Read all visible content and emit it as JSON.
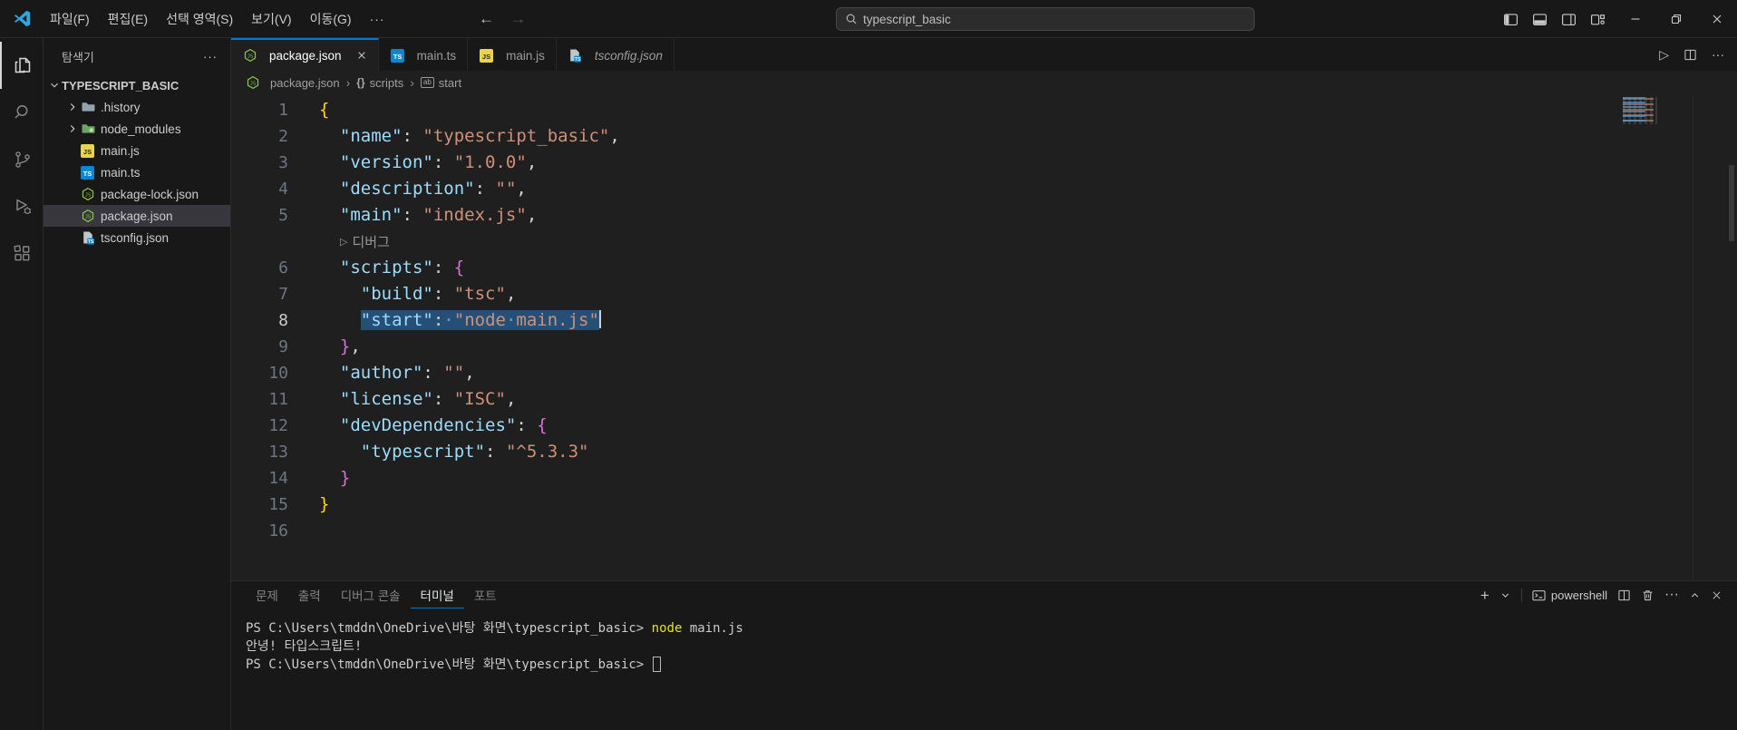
{
  "colors": {
    "accent": "#0078d4",
    "selection": "#264f78",
    "terminal_command_color": "#e5e510",
    "syntax": {
      "k": "#9cdcfe",
      "s": "#ce9178",
      "p": "#d4d4d4",
      "b1": "#ffd700",
      "b2": "#da70d6",
      "w": "#7e97ad"
    }
  },
  "titlebar": {
    "menus": [
      "파일(F)",
      "편집(E)",
      "선택 영역(S)",
      "보기(V)",
      "이동(G)"
    ],
    "menus_overflow": "···",
    "search_text": "typescript_basic"
  },
  "activity_bar": {
    "items": [
      {
        "name": "explorer",
        "active": true
      },
      {
        "name": "search",
        "active": false
      },
      {
        "name": "source-control",
        "active": false
      },
      {
        "name": "run-debug",
        "active": false
      },
      {
        "name": "extensions",
        "active": false
      }
    ]
  },
  "sidebar": {
    "title": "탐색기",
    "title_actions": "···",
    "root_label": "TYPESCRIPT_BASIC",
    "items": [
      {
        "label": ".history",
        "icon": "folder-gray",
        "expandable": true,
        "selected": false
      },
      {
        "label": "node_modules",
        "icon": "folder-green",
        "expandable": true,
        "selected": false
      },
      {
        "label": "main.js",
        "icon": "js",
        "expandable": false,
        "selected": false
      },
      {
        "label": "main.ts",
        "icon": "ts",
        "expandable": false,
        "selected": false
      },
      {
        "label": "package-lock.json",
        "icon": "npm",
        "expandable": false,
        "selected": false
      },
      {
        "label": "package.json",
        "icon": "npm",
        "expandable": false,
        "selected": true
      },
      {
        "label": "tsconfig.json",
        "icon": "tsconfig",
        "expandable": false,
        "selected": false
      }
    ]
  },
  "tabs": [
    {
      "label": "package.json",
      "icon": "npm",
      "active": true,
      "closable": true,
      "italic": false
    },
    {
      "label": "main.ts",
      "icon": "ts",
      "active": false,
      "closable": false,
      "italic": false
    },
    {
      "label": "main.js",
      "icon": "js",
      "active": false,
      "closable": false,
      "italic": false
    },
    {
      "label": "tsconfig.json",
      "icon": "tsconfig",
      "active": false,
      "closable": false,
      "italic": true
    }
  ],
  "editor_actions": {
    "run": "▷",
    "more": "···"
  },
  "breadcrumb": {
    "separator": "›",
    "items": [
      {
        "label": "package.json",
        "icon": "npm"
      },
      {
        "label": "scripts",
        "icon": "braces",
        "glyph": "{}"
      },
      {
        "label": "start",
        "icon": "symbol-string",
        "glyph": "ab"
      }
    ]
  },
  "editor": {
    "lines": [
      {
        "n": 1,
        "t": [
          [
            "{",
            "b1"
          ]
        ]
      },
      {
        "n": 2,
        "t": [
          [
            "  ",
            "p"
          ],
          [
            "\"name\"",
            "k"
          ],
          [
            ": ",
            "p"
          ],
          [
            "\"typescript_basic\"",
            "s"
          ],
          [
            ",",
            "p"
          ]
        ]
      },
      {
        "n": 3,
        "t": [
          [
            "  ",
            "p"
          ],
          [
            "\"version\"",
            "k"
          ],
          [
            ": ",
            "p"
          ],
          [
            "\"1.0.0\"",
            "s"
          ],
          [
            ",",
            "p"
          ]
        ]
      },
      {
        "n": 4,
        "t": [
          [
            "  ",
            "p"
          ],
          [
            "\"description\"",
            "k"
          ],
          [
            ": ",
            "p"
          ],
          [
            "\"\"",
            "s"
          ],
          [
            ",",
            "p"
          ]
        ]
      },
      {
        "n": 5,
        "t": [
          [
            "  ",
            "p"
          ],
          [
            "\"main\"",
            "k"
          ],
          [
            ": ",
            "p"
          ],
          [
            "\"index.js\"",
            "s"
          ],
          [
            ",",
            "p"
          ]
        ]
      },
      {
        "lens": "디버그",
        "lens_icon": "▷"
      },
      {
        "n": 6,
        "t": [
          [
            "  ",
            "p"
          ],
          [
            "\"scripts\"",
            "k"
          ],
          [
            ": ",
            "p"
          ],
          [
            "{",
            "b2"
          ]
        ]
      },
      {
        "n": 7,
        "t": [
          [
            "    ",
            "p"
          ],
          [
            "\"build\"",
            "k"
          ],
          [
            ": ",
            "p"
          ],
          [
            "\"tsc\"",
            "s"
          ],
          [
            ",",
            "p"
          ]
        ]
      },
      {
        "n": 8,
        "t": [
          [
            "    ",
            "p"
          ]
        ],
        "sel": [
          [
            "\"start\"",
            "k"
          ],
          [
            ":",
            "p"
          ],
          [
            "·",
            "w"
          ],
          [
            "\"node",
            "s"
          ],
          [
            "·",
            "w"
          ],
          [
            "main.js\"",
            "s"
          ]
        ],
        "cursor": true,
        "current": true
      },
      {
        "n": 9,
        "t": [
          [
            "  ",
            "p"
          ],
          [
            "}",
            "b2"
          ],
          [
            ",",
            "p"
          ]
        ]
      },
      {
        "n": 10,
        "t": [
          [
            "  ",
            "p"
          ],
          [
            "\"author\"",
            "k"
          ],
          [
            ": ",
            "p"
          ],
          [
            "\"\"",
            "s"
          ],
          [
            ",",
            "p"
          ]
        ]
      },
      {
        "n": 11,
        "t": [
          [
            "  ",
            "p"
          ],
          [
            "\"license\"",
            "k"
          ],
          [
            ": ",
            "p"
          ],
          [
            "\"ISC\"",
            "s"
          ],
          [
            ",",
            "p"
          ]
        ]
      },
      {
        "n": 12,
        "t": [
          [
            "  ",
            "p"
          ],
          [
            "\"devDependencies\"",
            "k"
          ],
          [
            ": ",
            "p"
          ],
          [
            "{",
            "b2"
          ]
        ]
      },
      {
        "n": 13,
        "t": [
          [
            "    ",
            "p"
          ],
          [
            "\"typescript\"",
            "k"
          ],
          [
            ": ",
            "p"
          ],
          [
            "\"^5.3.3\"",
            "s"
          ]
        ]
      },
      {
        "n": 14,
        "t": [
          [
            "  ",
            "p"
          ],
          [
            "}",
            "b2"
          ]
        ]
      },
      {
        "n": 15,
        "t": [
          [
            "}",
            "b1"
          ]
        ]
      },
      {
        "n": 16,
        "t": []
      }
    ]
  },
  "panel": {
    "tabs": [
      {
        "label": "문제",
        "active": false
      },
      {
        "label": "출력",
        "active": false
      },
      {
        "label": "디버그 콘솔",
        "active": false
      },
      {
        "label": "터미널",
        "active": true
      },
      {
        "label": "포트",
        "active": false
      }
    ],
    "toolbar": {
      "new_terminal": "+",
      "shell_label": "powershell",
      "more": "···"
    },
    "terminal_lines": [
      {
        "segs": [
          [
            "PS C:\\Users\\tmddn\\OneDrive\\바탕 화면\\typescript_basic> ",
            "d"
          ],
          [
            "node",
            "y"
          ],
          [
            " main.js",
            "d"
          ]
        ],
        "cursor": false
      },
      {
        "segs": [
          [
            "안녕! 타입스크립트!",
            "d"
          ]
        ],
        "cursor": false
      },
      {
        "segs": [
          [
            "PS C:\\Users\\tmddn\\OneDrive\\바탕 화면\\typescript_basic> ",
            "d"
          ]
        ],
        "cursor": true
      }
    ]
  }
}
